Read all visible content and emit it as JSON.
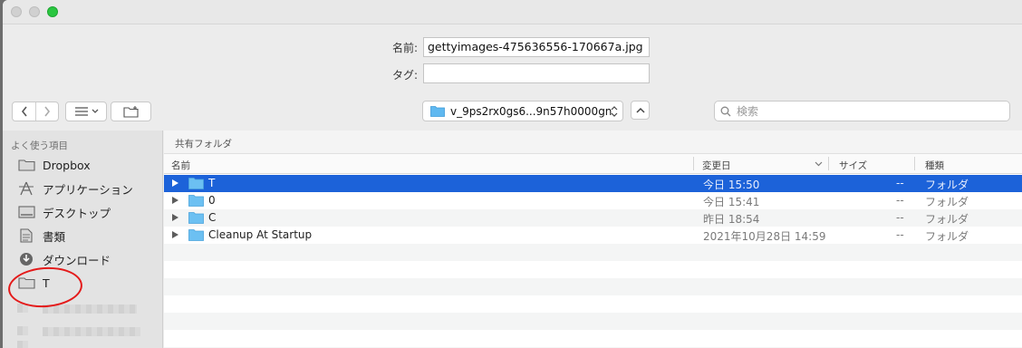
{
  "form": {
    "name_label": "名前:",
    "name_value": "gettyimages-475636556-170667a.jpg",
    "tag_label": "タグ:",
    "tag_value": ""
  },
  "toolbar": {
    "location": "v_9ps2rx0gs6...9n57h0000gn",
    "search_placeholder": "検索"
  },
  "sidebar": {
    "heading": "よく使う項目",
    "items": [
      {
        "label": "Dropbox",
        "icon": "folder-icon"
      },
      {
        "label": "アプリケーション",
        "icon": "applications-icon"
      },
      {
        "label": "デスクトップ",
        "icon": "desktop-icon"
      },
      {
        "label": "書類",
        "icon": "document-icon"
      },
      {
        "label": "ダウンロード",
        "icon": "download-icon"
      },
      {
        "label": "T",
        "icon": "folder-icon"
      }
    ]
  },
  "content": {
    "path_title": "共有フォルダ",
    "columns": {
      "name": "名前",
      "modified": "変更日",
      "size": "サイズ",
      "kind": "種類"
    },
    "rows": [
      {
        "name": "T",
        "modified": "今日 15:50",
        "size": "--",
        "kind": "フォルダ",
        "selected": true
      },
      {
        "name": "0",
        "modified": "今日 15:41",
        "size": "--",
        "kind": "フォルダ",
        "selected": false
      },
      {
        "name": "C",
        "modified": "昨日 18:54",
        "size": "--",
        "kind": "フォルダ",
        "selected": false
      },
      {
        "name": "Cleanup At Startup",
        "modified": "2021年10月28日 14:59",
        "size": "--",
        "kind": "フォルダ",
        "selected": false
      }
    ]
  },
  "colors": {
    "selection": "#1c62d9",
    "annotation": "#e41a1a",
    "folder": "#5fb8f0"
  }
}
